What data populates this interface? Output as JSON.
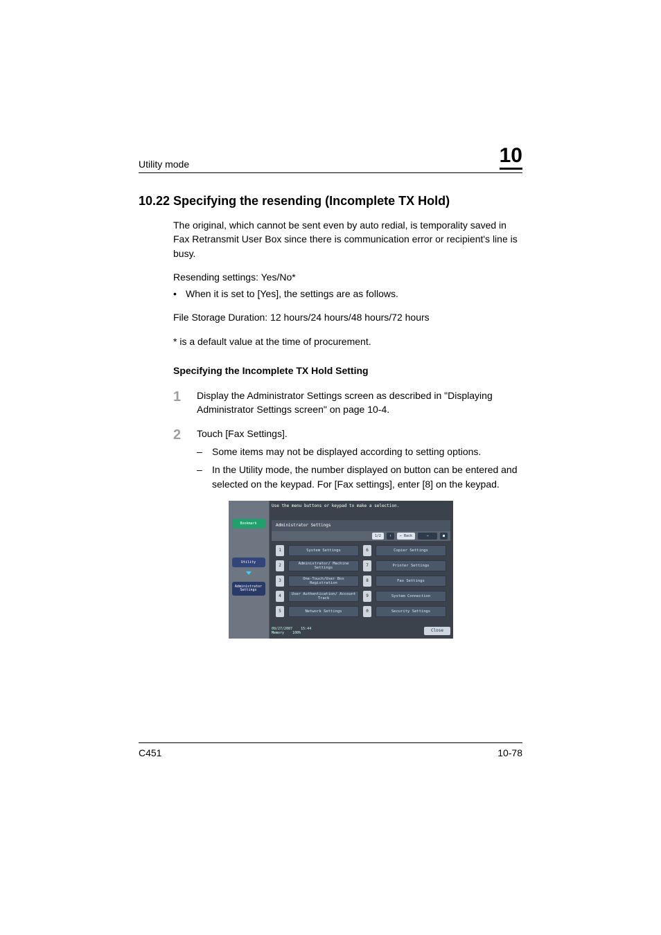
{
  "header": {
    "left": "Utility mode",
    "chapter": "10"
  },
  "section_title": "10.22 Specifying the resending (Incomplete TX Hold)",
  "para1": "The original, which cannot be sent even by auto redial, is temporality saved in Fax Retransmit User Box since there is communication error or recipient's line is busy.",
  "para2": "Resending settings: Yes/No*",
  "bullet1": "When it is set to [Yes], the settings are as follows.",
  "para3": "File Storage Duration: 12 hours/24 hours/48 hours/72 hours",
  "para4": "* is a default value at the time of procurement.",
  "sub_heading": "Specifying the Incomplete TX Hold Setting",
  "step1_num": "1",
  "step1_body": "Display the Administrator Settings screen as described in \"Displaying Administrator Settings screen\" on page 10-4.",
  "step2_num": "2",
  "step2_body": "Touch [Fax Settings].",
  "step2_sub1": "Some items may not be displayed according to setting options.",
  "step2_sub2": "In the Utility mode, the number displayed on button can be entered and selected on the keypad. For [Fax settings], enter [8] on the keypad.",
  "footer": {
    "left": "C451",
    "right": "10-78"
  },
  "shot": {
    "hint": "Use the menu buttons or keypad to make a selection.",
    "sidebar": {
      "bookmark": "Bookmark",
      "utility": "Utility",
      "admin_l1": "Administrator",
      "admin_l2": "Settings"
    },
    "panel_title": "Administrator Settings",
    "toolbar": {
      "page": "1/2",
      "back": "← Back"
    },
    "menu": [
      {
        "n": "1",
        "label": "System Settings"
      },
      {
        "n": "6",
        "label": "Copier Settings"
      },
      {
        "n": "2",
        "label": "Administrator/\nMachine Settings"
      },
      {
        "n": "7",
        "label": "Printer Settings"
      },
      {
        "n": "3",
        "label": "One-Touch/User Box\nRegistration"
      },
      {
        "n": "8",
        "label": "Fax Settings"
      },
      {
        "n": "4",
        "label": "User Authentication/\nAccount Track"
      },
      {
        "n": "9",
        "label": "System Connection"
      },
      {
        "n": "5",
        "label": "Network Settings"
      },
      {
        "n": "0",
        "label": "Security Settings"
      }
    ],
    "status": {
      "date": "09/27/2007",
      "time": "15:44",
      "mem_label": "Memory",
      "mem_val": "100%",
      "close": "Close"
    }
  }
}
